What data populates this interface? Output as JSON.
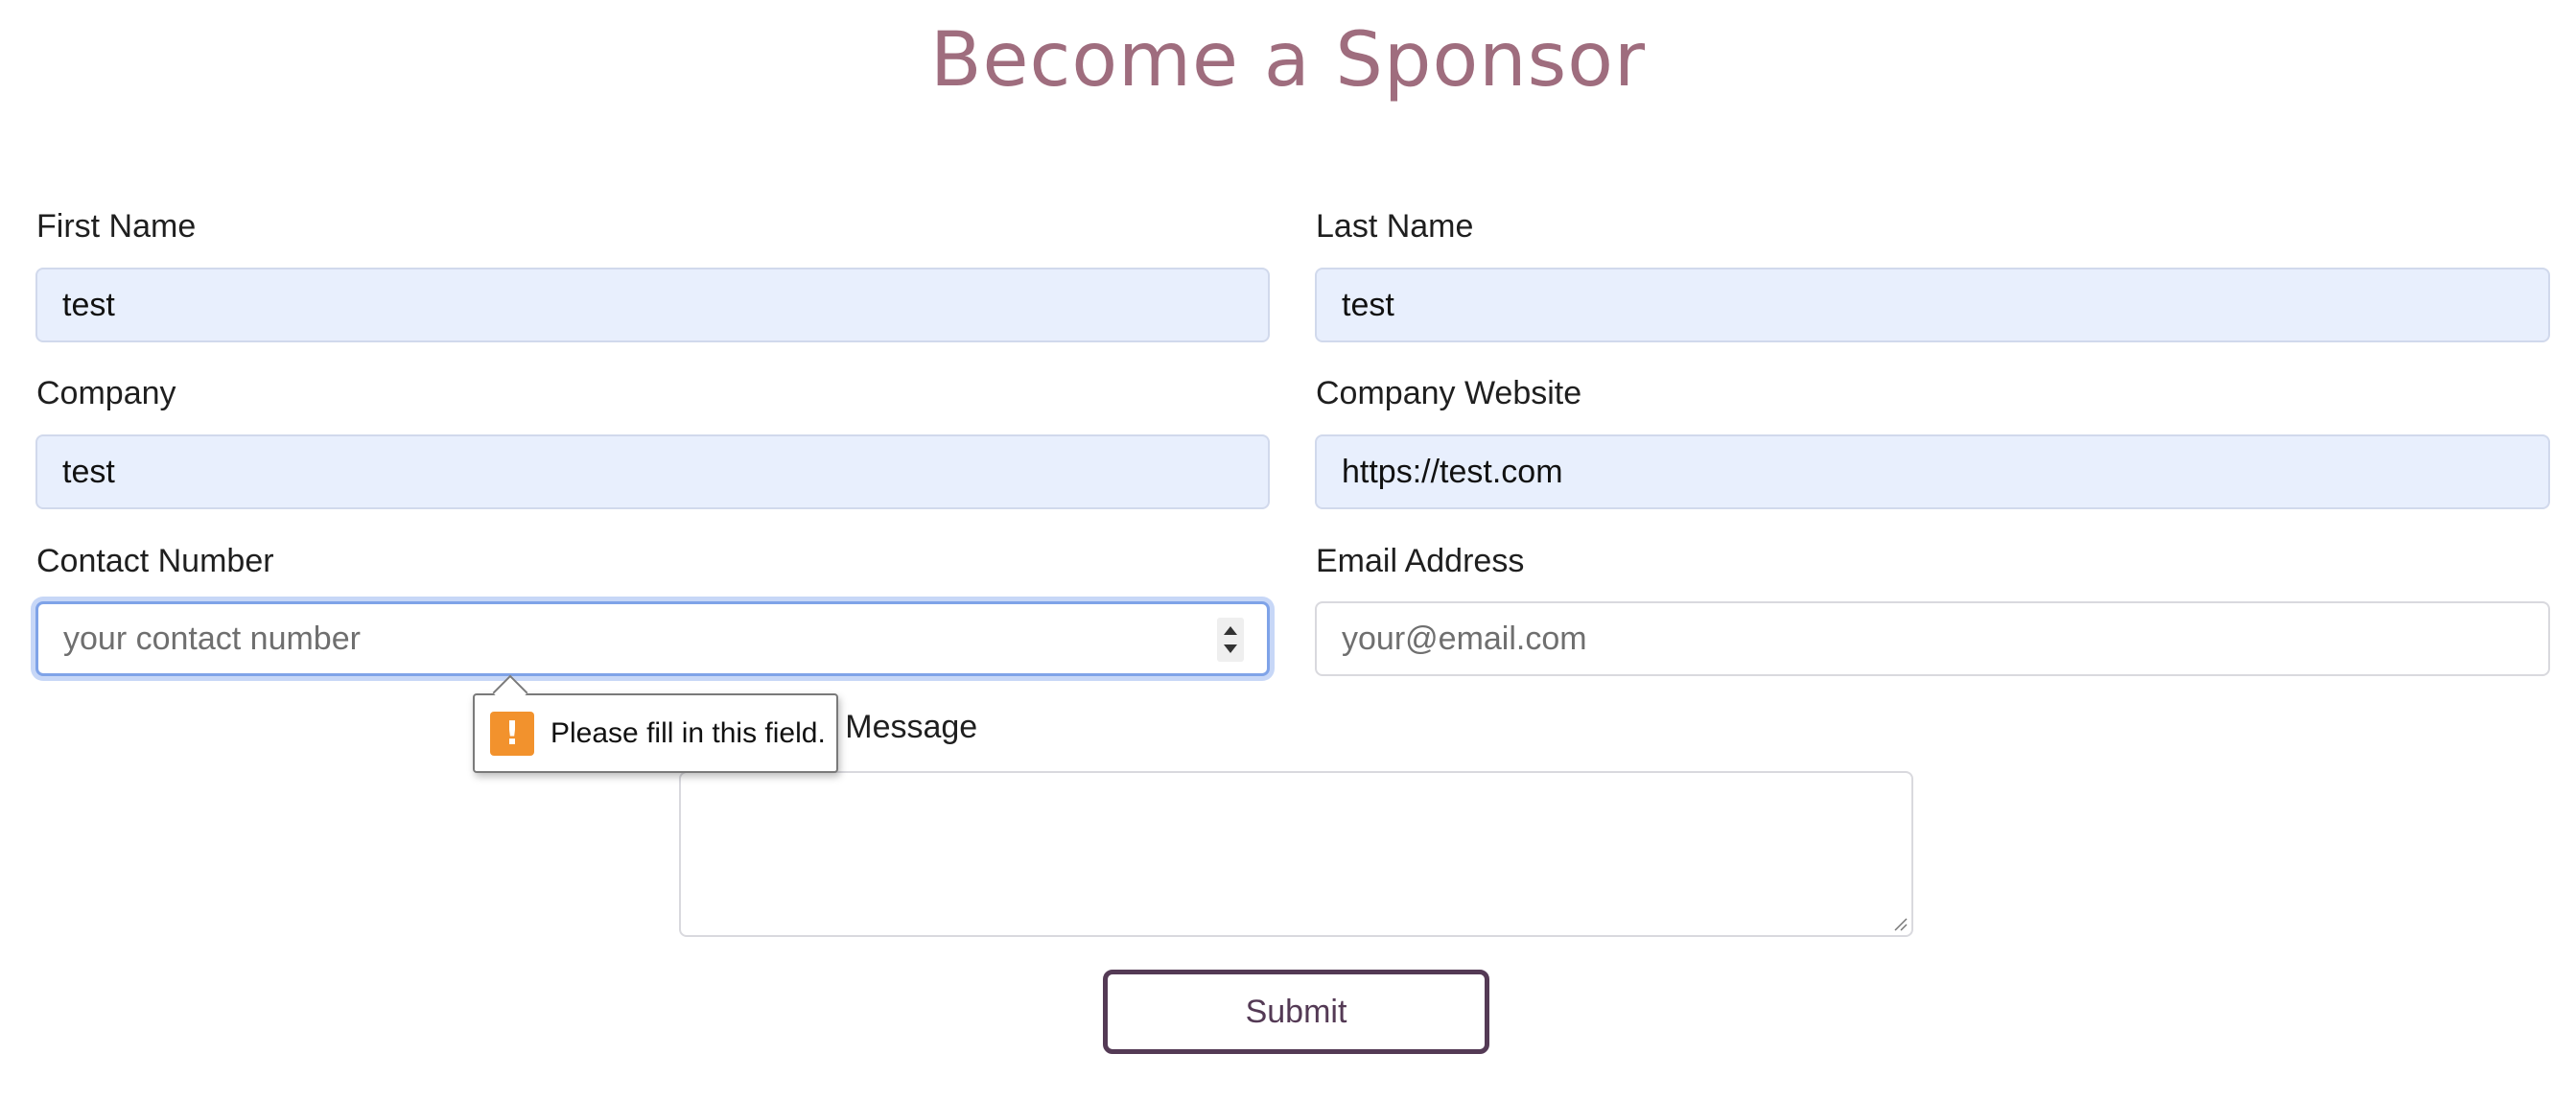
{
  "page_title": "Become a Sponsor",
  "form": {
    "first_name": {
      "label": "First Name",
      "value": "test"
    },
    "last_name": {
      "label": "Last Name",
      "value": "test"
    },
    "company": {
      "label": "Company",
      "value": "test"
    },
    "company_website": {
      "label": "Company Website",
      "value": "https://test.com"
    },
    "contact_number": {
      "label": "Contact Number",
      "value": "",
      "placeholder": "your contact number"
    },
    "email": {
      "label": "Email Address",
      "value": "",
      "placeholder": "your@email.com"
    },
    "message": {
      "label": "Message",
      "visible_label": "A Message",
      "value": ""
    },
    "submit_label": "Submit"
  },
  "validation_tooltip": {
    "message": "Please fill in this field.",
    "icon": "warning-icon"
  },
  "colors": {
    "title": "#9f6d7e",
    "submit_border": "#543a55",
    "autofill_bg": "#e8effd",
    "focus_ring": "#7fa3e8",
    "warning": "#f2922d"
  }
}
